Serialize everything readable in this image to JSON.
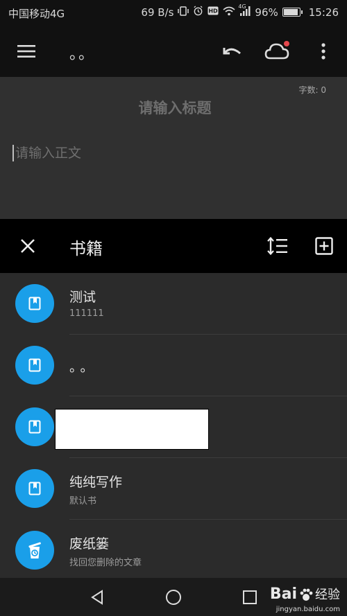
{
  "status_bar": {
    "carrier": "中国移动4G",
    "speed": "69 B/s",
    "network": "4G",
    "battery": "96%",
    "time": "15:26"
  },
  "app_bar": {
    "title": "。。"
  },
  "editor": {
    "word_count": "字数: 0",
    "title_placeholder": "请输入标题",
    "body_placeholder": "请输入正文"
  },
  "panel": {
    "title": "书籍"
  },
  "books": [
    {
      "name": "测试",
      "sub": "111111"
    },
    {
      "name": "。。",
      "sub": ""
    },
    {
      "name": "",
      "sub": ""
    },
    {
      "name": "纯纯写作",
      "sub": "默认书"
    },
    {
      "name": "废纸篓",
      "sub": "找回您删除的文章"
    }
  ],
  "watermark": {
    "brand": "Bai",
    "brand2": "经验",
    "url": "jingyan.baidu.com"
  },
  "colors": {
    "accent": "#1a9fe9",
    "badge": "#e5484d"
  },
  "icons": {
    "menu": "menu-icon",
    "undo": "undo-icon",
    "cloud": "cloud-icon",
    "more": "more-vert-icon",
    "close": "close-icon",
    "sort": "sort-icon",
    "add": "add-box-icon",
    "book": "book-icon",
    "trash": "trash-icon"
  }
}
